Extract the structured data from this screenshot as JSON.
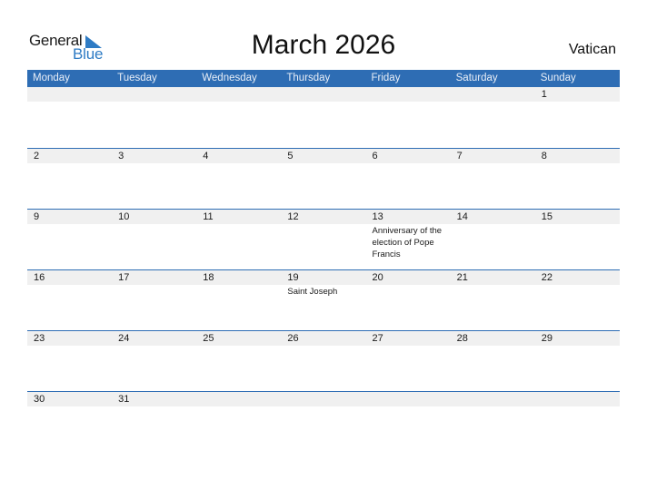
{
  "logo": {
    "line1": "General",
    "line2": "Blue"
  },
  "title": "March 2026",
  "country": "Vatican",
  "colors": {
    "accent": "#2E6DB4",
    "strip": "#f0f0f0",
    "logo_blue": "#2E7BC4"
  },
  "weekdays": [
    "Monday",
    "Tuesday",
    "Wednesday",
    "Thursday",
    "Friday",
    "Saturday",
    "Sunday"
  ],
  "weeks": [
    {
      "days": [
        {
          "num": "",
          "event": ""
        },
        {
          "num": "",
          "event": ""
        },
        {
          "num": "",
          "event": ""
        },
        {
          "num": "",
          "event": ""
        },
        {
          "num": "",
          "event": ""
        },
        {
          "num": "",
          "event": ""
        },
        {
          "num": "1",
          "event": ""
        }
      ]
    },
    {
      "days": [
        {
          "num": "2",
          "event": ""
        },
        {
          "num": "3",
          "event": ""
        },
        {
          "num": "4",
          "event": ""
        },
        {
          "num": "5",
          "event": ""
        },
        {
          "num": "6",
          "event": ""
        },
        {
          "num": "7",
          "event": ""
        },
        {
          "num": "8",
          "event": ""
        }
      ]
    },
    {
      "days": [
        {
          "num": "9",
          "event": ""
        },
        {
          "num": "10",
          "event": ""
        },
        {
          "num": "11",
          "event": ""
        },
        {
          "num": "12",
          "event": ""
        },
        {
          "num": "13",
          "event": "Anniversary of the election of Pope Francis"
        },
        {
          "num": "14",
          "event": ""
        },
        {
          "num": "15",
          "event": ""
        }
      ]
    },
    {
      "days": [
        {
          "num": "16",
          "event": ""
        },
        {
          "num": "17",
          "event": ""
        },
        {
          "num": "18",
          "event": ""
        },
        {
          "num": "19",
          "event": "Saint Joseph"
        },
        {
          "num": "20",
          "event": ""
        },
        {
          "num": "21",
          "event": ""
        },
        {
          "num": "22",
          "event": ""
        }
      ]
    },
    {
      "days": [
        {
          "num": "23",
          "event": ""
        },
        {
          "num": "24",
          "event": ""
        },
        {
          "num": "25",
          "event": ""
        },
        {
          "num": "26",
          "event": ""
        },
        {
          "num": "27",
          "event": ""
        },
        {
          "num": "28",
          "event": ""
        },
        {
          "num": "29",
          "event": ""
        }
      ]
    },
    {
      "days": [
        {
          "num": "30",
          "event": ""
        },
        {
          "num": "31",
          "event": ""
        },
        {
          "num": "",
          "event": ""
        },
        {
          "num": "",
          "event": ""
        },
        {
          "num": "",
          "event": ""
        },
        {
          "num": "",
          "event": ""
        },
        {
          "num": "",
          "event": ""
        }
      ]
    }
  ]
}
